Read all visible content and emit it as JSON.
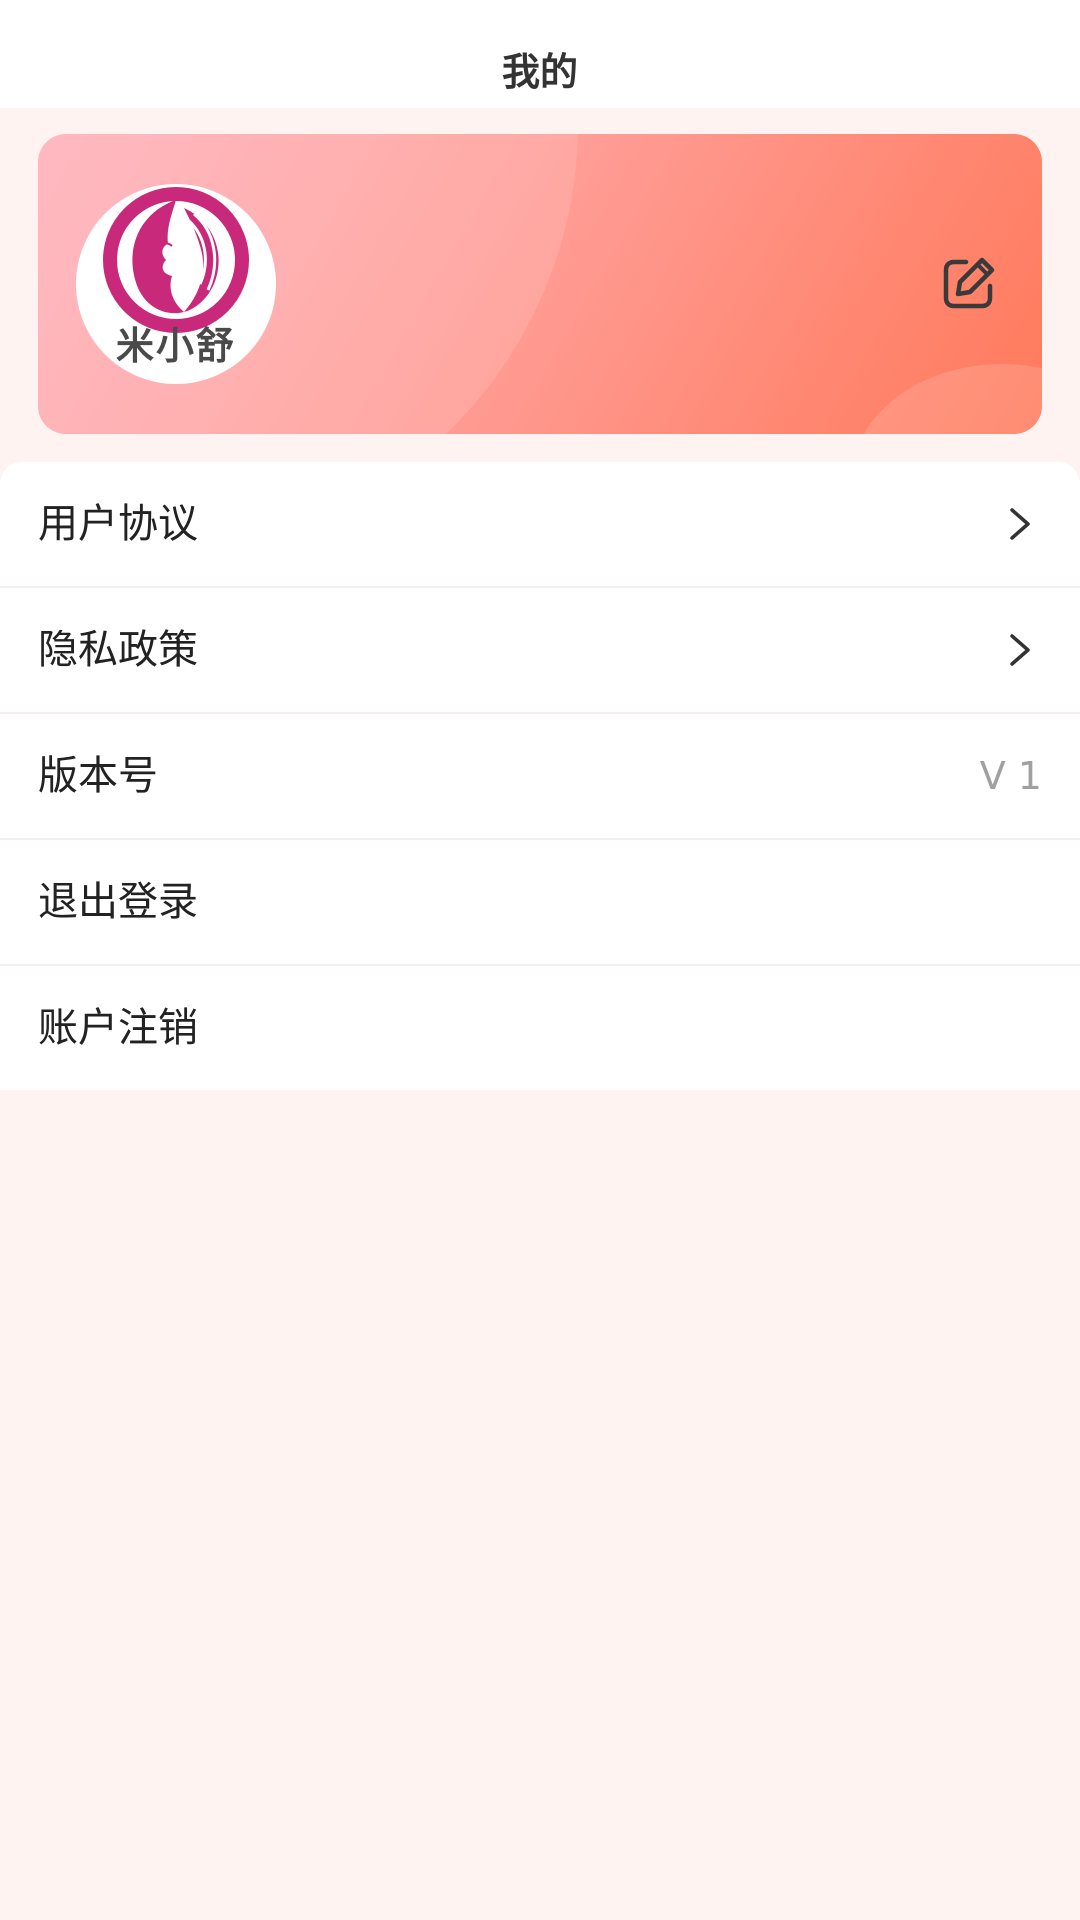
{
  "header": {
    "title": "我的"
  },
  "profile": {
    "avatar_logo_text": "米小舒",
    "avatar_icon": "woman-profile-logo",
    "edit_icon": "edit-icon"
  },
  "menu": {
    "items": [
      {
        "label": "用户协议",
        "icon": "chevron-right-icon"
      },
      {
        "label": "隐私政策",
        "icon": "chevron-right-icon"
      },
      {
        "label": "版本号",
        "value": "V 1"
      },
      {
        "label": "退出登录"
      },
      {
        "label": "账户注销"
      }
    ]
  },
  "colors": {
    "page_background": "#fef3f1",
    "card_gradient_start": "#ffb0ba",
    "card_gradient_end": "#ff7a5c",
    "logo_magenta": "#c8297a",
    "text_primary": "#222222",
    "text_secondary": "#a0a0a0"
  }
}
